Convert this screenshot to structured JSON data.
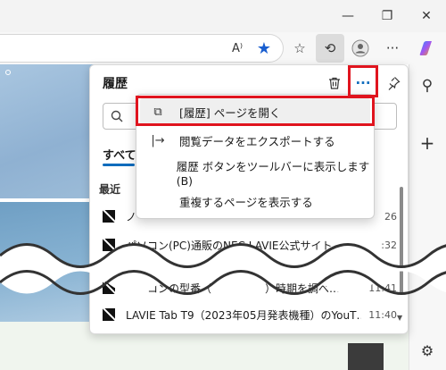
{
  "colors": {
    "highlight": "#e0141e",
    "accent": "#0f6cbd"
  },
  "titlebar": {
    "min_icon": "minimize-icon",
    "restore_icon": "restore-icon",
    "close_icon": "close-icon",
    "min_glyph": "—",
    "restore_glyph": "❐",
    "close_glyph": "✕"
  },
  "toolbar": {
    "read_aloud_glyph": "A⁾",
    "favorite_glyph": "★",
    "favorites_glyph": "☆",
    "history_glyph": "⟲",
    "profile_glyph": "◯",
    "more_glyph": "···"
  },
  "history_panel": {
    "title": "履歴",
    "tab_all": "すべて",
    "section_recent": "最近",
    "more_glyph": "···",
    "delete_glyph": "🗑",
    "pin_glyph": "📌",
    "items": [
      {
        "title": "ノ",
        "time": "26"
      },
      {
        "title": "パソコン(PC)通販のNEC LAVIE公式サイト",
        "time": ":32"
      },
      {
        "title": "パソコンの型番（　　　　　）時期を調べ…",
        "time": "11:41"
      },
      {
        "title": "LAVIE Tab T9（2023年05月発表機種）のYouT…",
        "time": "11:40"
      }
    ]
  },
  "more_menu": {
    "items": [
      {
        "label": "[履歴] ページを開く",
        "icon": "external-link-icon",
        "glyph": "⧉"
      },
      {
        "label": "閲覧データをエクスポートする",
        "icon": "export-icon",
        "glyph": "|→"
      },
      {
        "label": "履歴 ボタンをツールバーに表示します(B)",
        "icon": "",
        "glyph": ""
      },
      {
        "label": "重複するページを表示する",
        "icon": "",
        "glyph": ""
      }
    ]
  },
  "sidebar": {
    "copilot_icon": "copilot-icon",
    "search_glyph": "⚲",
    "add_glyph": "+",
    "settings_glyph": "⚙"
  }
}
